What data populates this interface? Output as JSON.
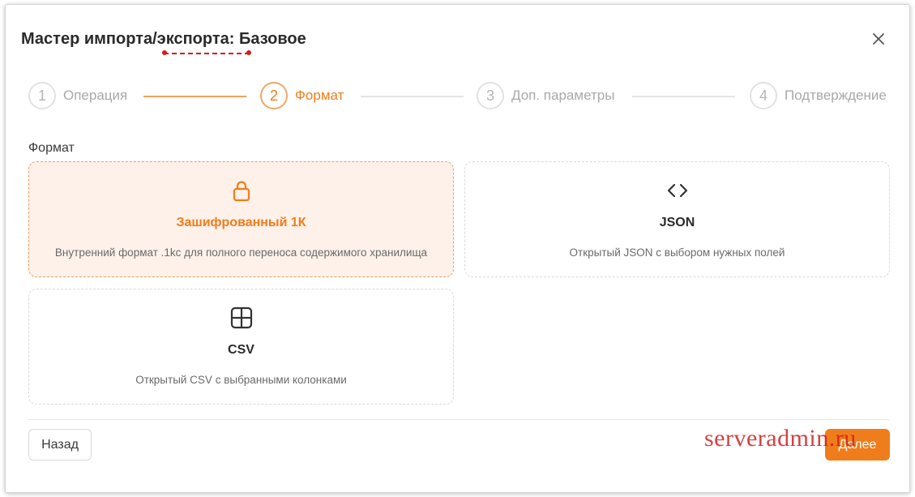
{
  "dialog": {
    "title": "Мастер импорта/экспорта: Базовое"
  },
  "steps": [
    {
      "number": "1",
      "label": "Операция",
      "state": "done"
    },
    {
      "number": "2",
      "label": "Формат",
      "state": "active"
    },
    {
      "number": "3",
      "label": "Доп. параметры",
      "state": "pending"
    },
    {
      "number": "4",
      "label": "Подтверждение",
      "state": "pending"
    }
  ],
  "format": {
    "label": "Формат",
    "options": [
      {
        "icon": "lock-icon",
        "title": "Зашифрованный 1К",
        "description": "Внутренний формат .1kc для полного переноса содержимого хранилища",
        "selected": true
      },
      {
        "icon": "code-icon",
        "title": "JSON",
        "description": "Открытый JSON с выбором нужных полей",
        "selected": false
      },
      {
        "icon": "grid-icon",
        "title": "CSV",
        "description": "Открытый CSV с выбранными колонками",
        "selected": false
      }
    ]
  },
  "footer": {
    "back_label": "Назад",
    "next_label": "Далее"
  },
  "watermark": "serveradmin.ru",
  "colors": {
    "accent": "#f07d1b",
    "selected_bg": "#fdf1ea",
    "watermark": "#ce1e1e"
  }
}
